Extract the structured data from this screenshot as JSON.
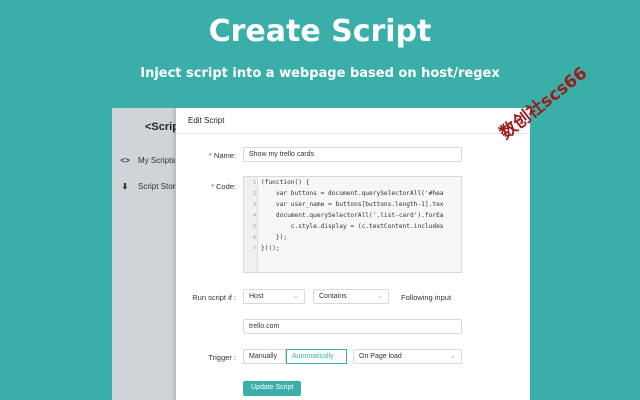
{
  "hero": {
    "title": "Create Script",
    "subtitle": "Inject script into a webpage based on host/regex"
  },
  "app": {
    "brand": "<Script"
  },
  "sidebar": {
    "items": [
      {
        "label": "My Scripts",
        "icon": "code-icon",
        "glyph": "<>"
      },
      {
        "label": "Script Store",
        "icon": "download-icon",
        "glyph": "⬇"
      }
    ]
  },
  "modal": {
    "title": "Edit Script",
    "close_glyph": "×"
  },
  "form": {
    "name_label": "Name:",
    "name_value": "Show my trello cards",
    "code_label": "Code:",
    "code_lines": [
      {
        "num": "1",
        "text": "(function() {"
      },
      {
        "num": "2",
        "text": "    var buttons = document.querySelectorAll('#hea"
      },
      {
        "num": "3",
        "text": "    var user_name = buttons[buttons.length-1].tex"
      },
      {
        "num": "4",
        "text": "    document.querySelectorAll('.list-card').forEa"
      },
      {
        "num": "5",
        "text": "        c.style.display = (c.textContent.includes"
      },
      {
        "num": "6",
        "text": "    });"
      },
      {
        "num": "7",
        "text": "})();"
      }
    ],
    "run_label": "Run script if :",
    "run_type": "Host",
    "run_op": "Contains",
    "run_hint": "Following input",
    "host_value": "trello.com",
    "trigger_label": "Trigger :",
    "trigger_manual": "Manually",
    "trigger_auto": "Automatically",
    "trigger_event": "On Page load",
    "submit_label": "Update Script"
  },
  "watermark": "数创社scs66",
  "colors": {
    "accent": "#3aafa9",
    "watermark": "#9e1b1b"
  }
}
